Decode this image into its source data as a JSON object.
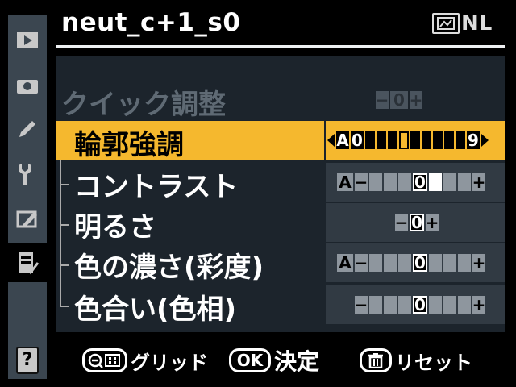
{
  "header": {
    "title": "neut_c+1_s0",
    "picture_control_badge": "NL"
  },
  "tabs": [
    {
      "icon": "playback-icon"
    },
    {
      "icon": "camera-icon"
    },
    {
      "icon": "pencil-icon"
    },
    {
      "icon": "wrench-icon"
    },
    {
      "icon": "retouch-icon"
    },
    {
      "icon": "recent-settings-icon",
      "active": true
    }
  ],
  "help_label": "?",
  "rows": [
    {
      "label": "クイック調整",
      "dimmed": true,
      "minus": "−",
      "center": "0",
      "plus": "+"
    },
    {
      "label": "輪郭強調",
      "selected": true,
      "auto": "A",
      "min": "0",
      "max": "9",
      "level": 3
    },
    {
      "label": "コントラスト",
      "auto": "A",
      "minus": "−",
      "center": "0",
      "plus": "+",
      "level": 1
    },
    {
      "label": "明るさ",
      "minus": "−",
      "center": "0",
      "plus": "+"
    },
    {
      "label": "色の濃さ(彩度)",
      "auto": "A",
      "minus": "−",
      "center": "0",
      "plus": "+",
      "level": 0
    },
    {
      "label": "色合い(色相)",
      "minus": "−",
      "center": "0",
      "plus": "+",
      "level": 0
    }
  ],
  "footer": {
    "grid_label": "グリッド",
    "ok_key": "OK",
    "ok_label": "決定",
    "reset_label": "リセット"
  },
  "colors": {
    "highlight": "#f5b82e",
    "panel": "#1c242c",
    "tabstrip": "#3b4650"
  }
}
